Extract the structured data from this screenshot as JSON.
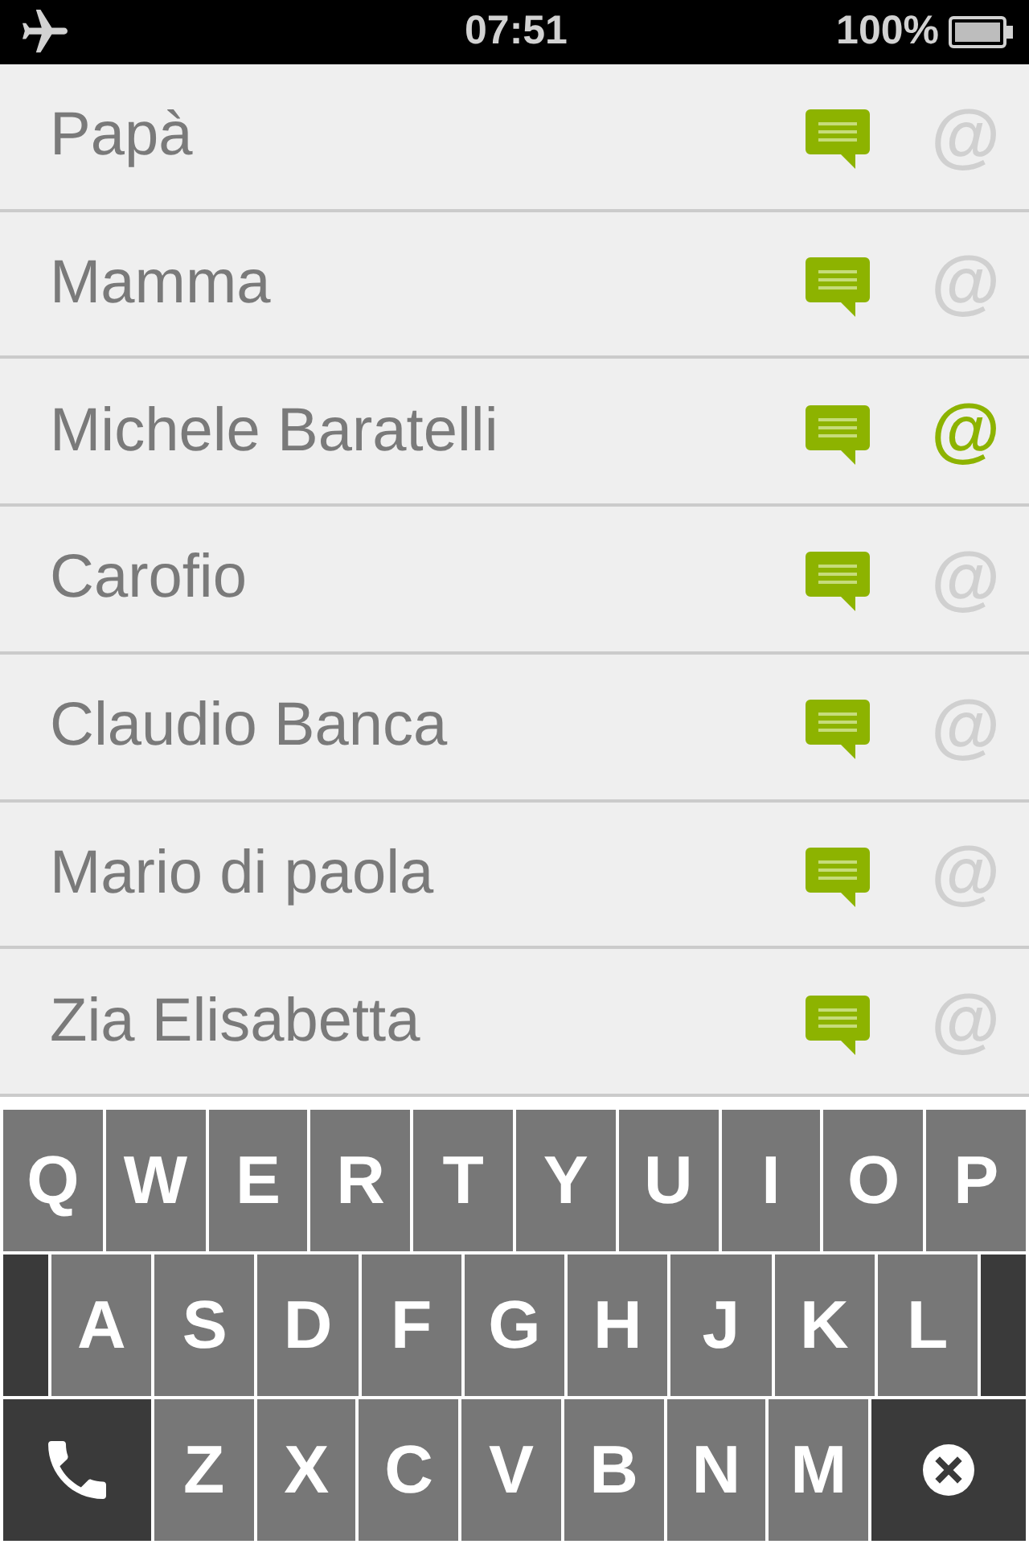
{
  "status_bar": {
    "time": "07:51",
    "battery": "100%"
  },
  "contacts": [
    {
      "name": "Papà",
      "email_button": "@",
      "email": false
    },
    {
      "name": "Mamma",
      "email_button": "@",
      "email": false
    },
    {
      "name": "Michele Baratelli",
      "email_button": "@",
      "email": true
    },
    {
      "name": "Carofio",
      "email_button": "@",
      "email": false
    },
    {
      "name": "Claudio Banca",
      "email_button": "@",
      "email": false
    },
    {
      "name": "Mario di paola",
      "email_button": "@",
      "email": false
    },
    {
      "name": "Zia Elisabetta",
      "email_button": "@",
      "email": false
    }
  ],
  "keyboard": {
    "rows": [
      [
        {
          "kind": "letter",
          "label": "Q"
        },
        {
          "kind": "letter",
          "label": "W"
        },
        {
          "kind": "letter",
          "label": "E"
        },
        {
          "kind": "letter",
          "label": "R"
        },
        {
          "kind": "letter",
          "label": "T"
        },
        {
          "kind": "letter",
          "label": "Y"
        },
        {
          "kind": "letter",
          "label": "U"
        },
        {
          "kind": "letter",
          "label": "I"
        },
        {
          "kind": "letter",
          "label": "O"
        },
        {
          "kind": "letter",
          "label": "P"
        }
      ],
      [
        {
          "kind": "spacer"
        },
        {
          "kind": "letter",
          "label": "A"
        },
        {
          "kind": "letter",
          "label": "S"
        },
        {
          "kind": "letter",
          "label": "D"
        },
        {
          "kind": "letter",
          "label": "F"
        },
        {
          "kind": "letter",
          "label": "G"
        },
        {
          "kind": "letter",
          "label": "H"
        },
        {
          "kind": "letter",
          "label": "J"
        },
        {
          "kind": "letter",
          "label": "K"
        },
        {
          "kind": "letter",
          "label": "L"
        },
        {
          "kind": "spacer"
        }
      ],
      [
        {
          "kind": "call"
        },
        {
          "kind": "letter",
          "label": "Z"
        },
        {
          "kind": "letter",
          "label": "X"
        },
        {
          "kind": "letter",
          "label": "C"
        },
        {
          "kind": "letter",
          "label": "V"
        },
        {
          "kind": "letter",
          "label": "B"
        },
        {
          "kind": "letter",
          "label": "N"
        },
        {
          "kind": "letter",
          "label": "M"
        },
        {
          "kind": "delete"
        }
      ]
    ]
  }
}
